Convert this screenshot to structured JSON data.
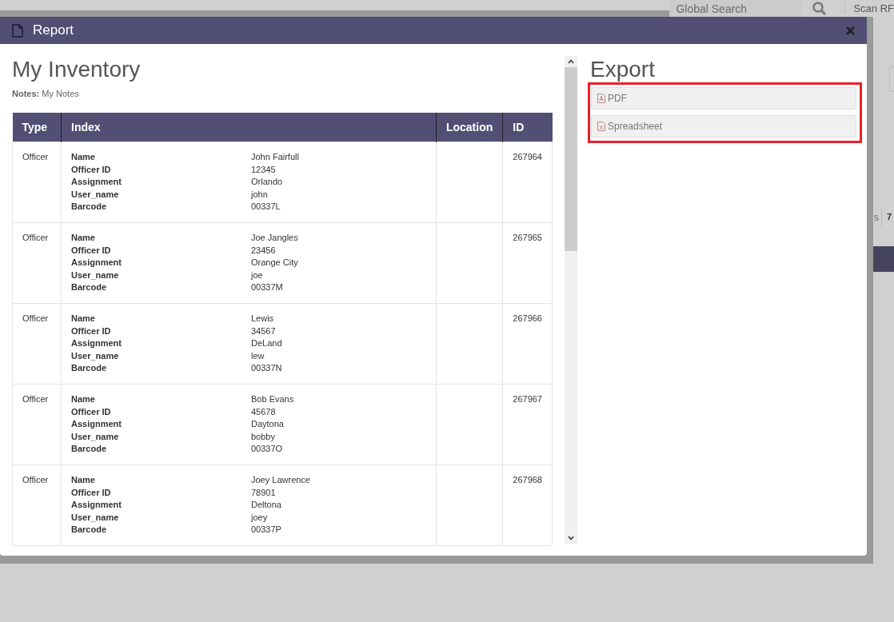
{
  "background": {
    "search": {
      "placeholder": "Global Search"
    },
    "scan_label": "Scan RF",
    "column_fragment": "s",
    "cell_fragment": "7"
  },
  "dialog": {
    "title": "Report",
    "heading": "My Inventory",
    "notes": "**Notes:** My Notes",
    "columns": [
      "Type",
      "Index",
      "Location",
      "ID"
    ],
    "rows": [
      {
        "type": "Officer",
        "fields": [
          {
            "label": "Name",
            "value": "John Fairfull"
          },
          {
            "label": "Officer ID",
            "value": "12345"
          },
          {
            "label": "Assignment",
            "value": "Orlando"
          },
          {
            "label": "User_name",
            "value": "john"
          },
          {
            "label": "Barcode",
            "value": "00337L"
          }
        ],
        "id": "267964"
      },
      {
        "type": "Officer",
        "fields": [
          {
            "label": "Name",
            "value": "Joe Jangles"
          },
          {
            "label": "Officer ID",
            "value": "23456"
          },
          {
            "label": "Assignment",
            "value": "Orange City"
          },
          {
            "label": "User_name",
            "value": "joe"
          },
          {
            "label": "Barcode",
            "value": "00337M"
          }
        ],
        "id": "267965"
      },
      {
        "type": "Officer",
        "fields": [
          {
            "label": "Name",
            "value": "Lewis"
          },
          {
            "label": "Officer ID",
            "value": "34567"
          },
          {
            "label": "Assignment",
            "value": "DeLand"
          },
          {
            "label": "User_name",
            "value": "lew"
          },
          {
            "label": "Barcode",
            "value": "00337N"
          }
        ],
        "id": "267966"
      },
      {
        "type": "Officer",
        "fields": [
          {
            "label": "Name",
            "value": "Bob Evans"
          },
          {
            "label": "Officer ID",
            "value": "45678"
          },
          {
            "label": "Assignment",
            "value": "Daytona"
          },
          {
            "label": "User_name",
            "value": "bobby"
          },
          {
            "label": "Barcode",
            "value": "00337O"
          }
        ],
        "id": "267967"
      },
      {
        "type": "Officer",
        "fields": [
          {
            "label": "Name",
            "value": "Joey Lawrence"
          },
          {
            "label": "Officer ID",
            "value": "78901"
          },
          {
            "label": "Assignment",
            "value": "Deltona"
          },
          {
            "label": "User_name",
            "value": "joey"
          },
          {
            "label": "Barcode",
            "value": "00337P"
          }
        ],
        "id": "267968"
      }
    ],
    "export": {
      "heading": "Export",
      "highlighted": true,
      "buttons": [
        {
          "kind": "pdf",
          "label": "PDF"
        },
        {
          "kind": "spreadsheet",
          "label": "Spreadsheet"
        }
      ]
    }
  }
}
